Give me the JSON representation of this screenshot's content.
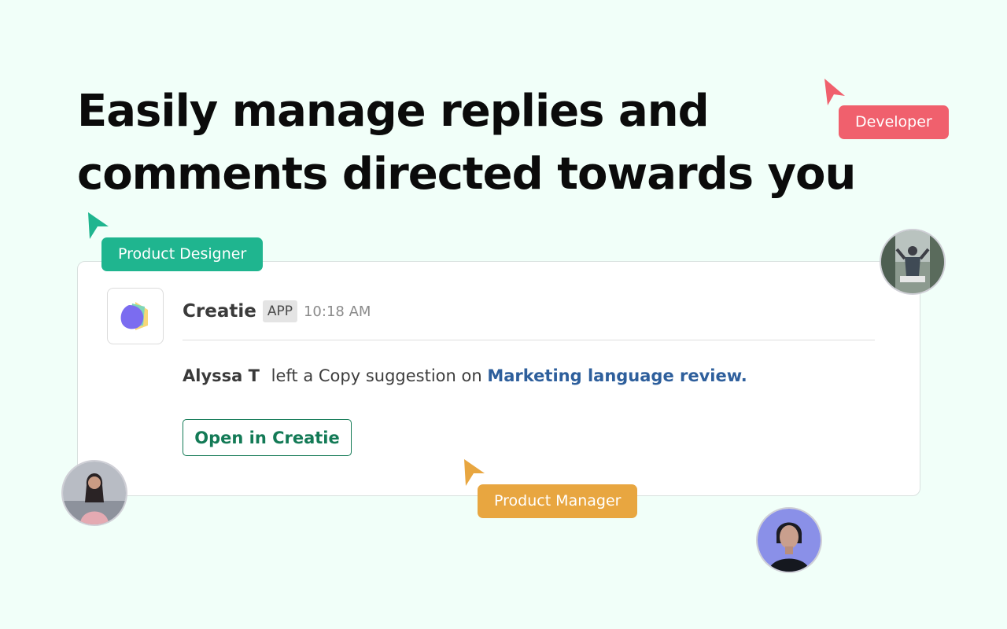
{
  "headline": {
    "line1": "Easily manage replies and",
    "line2": "comments directed towards you"
  },
  "tags": {
    "developer": {
      "label": "Developer",
      "color": "#f0606d"
    },
    "product_designer": {
      "label": "Product Designer",
      "color": "#1fb58f"
    },
    "product_manager": {
      "label": "Product Manager",
      "color": "#e8a640"
    }
  },
  "message": {
    "app_name": "Creatie",
    "badge": "APP",
    "time": "10:18 AM",
    "author": "Alyssa T",
    "text": "left a Copy suggestion on",
    "link": "Marketing language review.",
    "button_label": "Open in Creatie"
  },
  "colors": {
    "background": "#f1fff9",
    "accent_green": "#137a56",
    "link_blue": "#2e5f9c"
  },
  "icons": [
    "cursor-arrow-icon",
    "creatie-logo-icon"
  ]
}
